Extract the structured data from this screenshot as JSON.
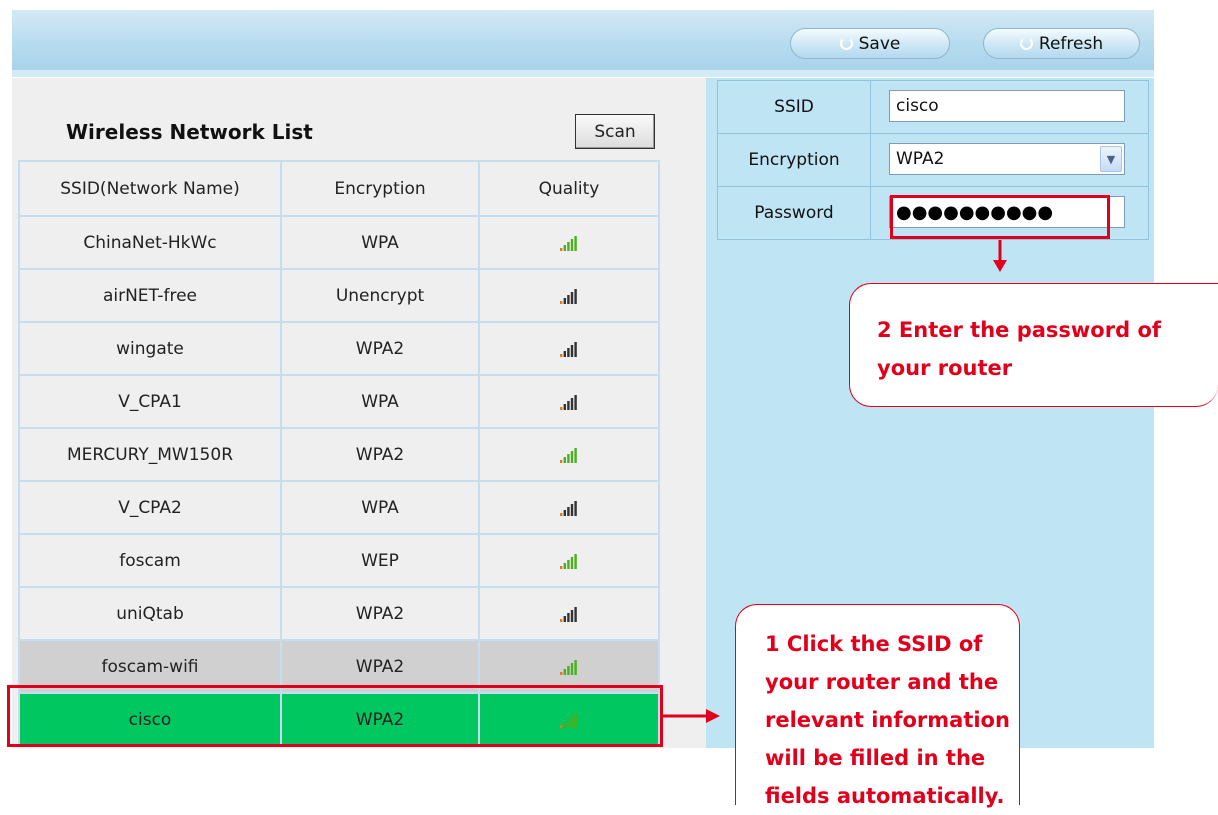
{
  "toolbar": {
    "save_label": "Save",
    "refresh_label": "Refresh"
  },
  "wireless_list": {
    "title": "Wireless Network List",
    "scan_label": "Scan",
    "columns": [
      "SSID(Network Name)",
      "Encryption",
      "Quality"
    ],
    "rows": [
      {
        "ssid": "ChinaNet-HkWc",
        "encryption": "WPA",
        "quality": "high"
      },
      {
        "ssid": "airNET-free",
        "encryption": "Unencrypt",
        "quality": "medium"
      },
      {
        "ssid": "wingate",
        "encryption": "WPA2",
        "quality": "medium"
      },
      {
        "ssid": "V_CPA1",
        "encryption": "WPA",
        "quality": "medium"
      },
      {
        "ssid": "MERCURY_MW150R",
        "encryption": "WPA2",
        "quality": "high"
      },
      {
        "ssid": "V_CPA2",
        "encryption": "WPA",
        "quality": "medium"
      },
      {
        "ssid": "foscam",
        "encryption": "WEP",
        "quality": "high"
      },
      {
        "ssid": "uniQtab",
        "encryption": "WPA2",
        "quality": "medium"
      },
      {
        "ssid": "foscam-wifi",
        "encryption": "WPA2",
        "quality": "high"
      },
      {
        "ssid": "cisco",
        "encryption": "WPA2",
        "quality": "high"
      }
    ]
  },
  "form": {
    "ssid_label": "SSID",
    "ssid_value": "cisco",
    "encryption_label": "Encryption",
    "encryption_value": "WPA2",
    "password_label": "Password",
    "password_value": "●●●●●●●●●●"
  },
  "annotations": {
    "callout_password": "2 Enter the password of your router",
    "callout_ssid": "1 Click the SSID of your router and the relevant information will be filled in the fields automatically."
  },
  "colors": {
    "accent_red": "#e0001b",
    "selected_green": "#00c75f",
    "selected_gray": "#d0d0d0",
    "panel_blue": "#bfe4f4",
    "signal_green": "#4caf1f"
  }
}
